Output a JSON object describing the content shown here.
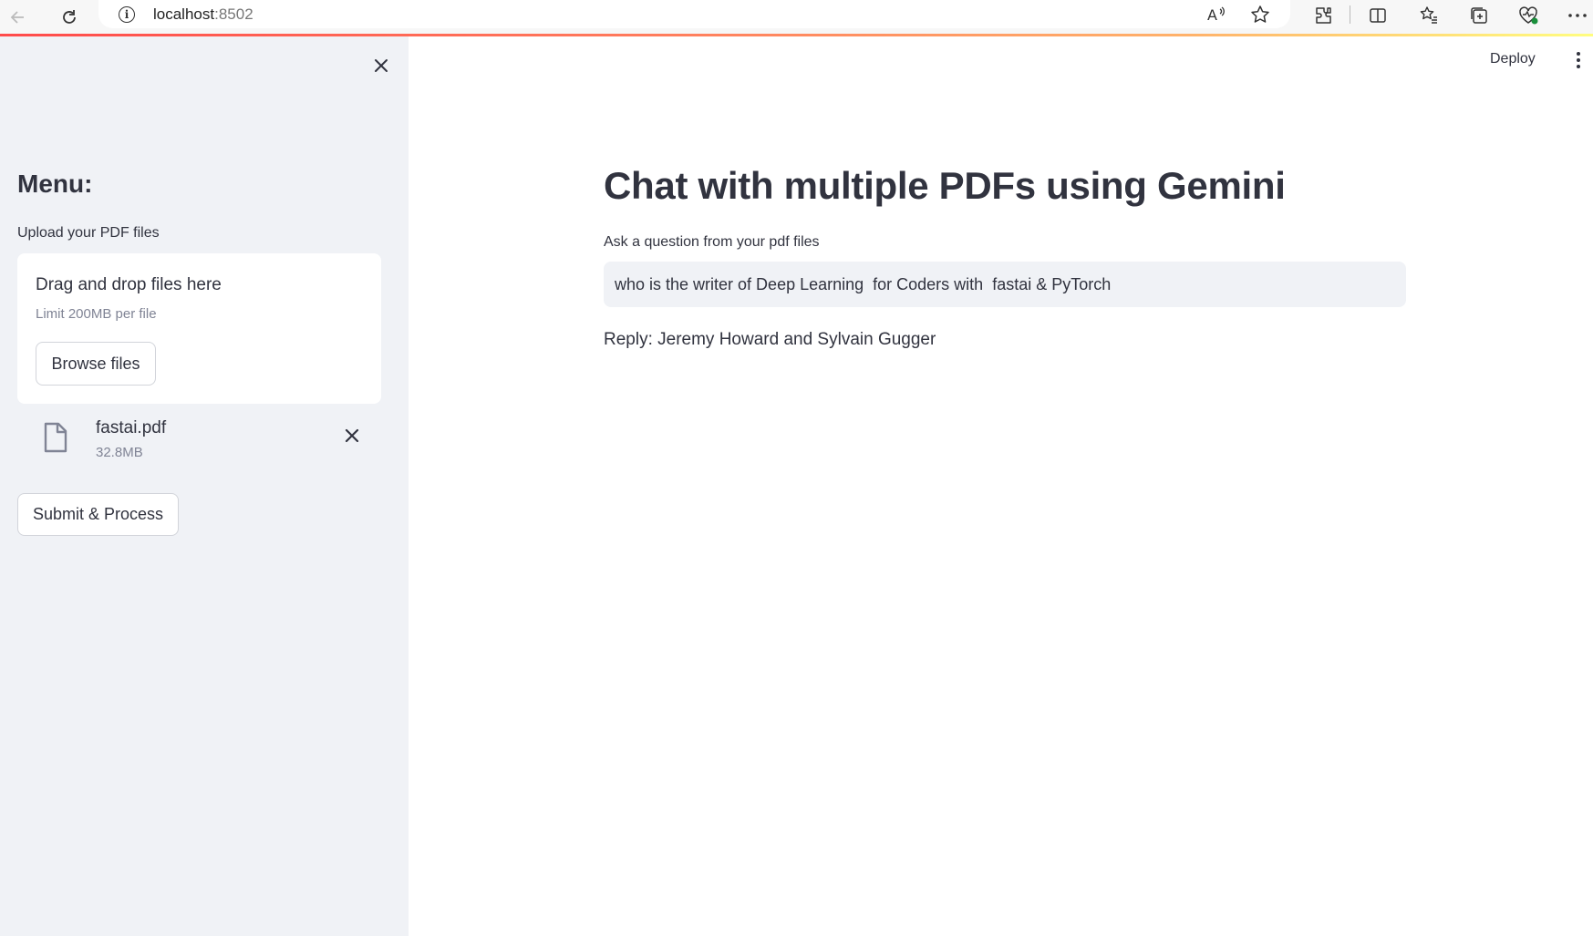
{
  "browser": {
    "url_host": "localhost",
    "url_port": ":8502"
  },
  "sidebar": {
    "title": "Menu:",
    "upload_label": "Upload your PDF files",
    "dropzone": {
      "title": "Drag and drop files here",
      "limit": "Limit 200MB per file",
      "browse_label": "Browse files"
    },
    "files": [
      {
        "name": "fastai.pdf",
        "size": "32.8MB"
      }
    ],
    "submit_label": "Submit & Process"
  },
  "header": {
    "deploy_label": "Deploy"
  },
  "main": {
    "title": "Chat with multiple PDFs using Gemini",
    "question_label": "Ask a question from your pdf files",
    "question_value": "who is the writer of Deep Learning  for Coders with  fastai & PyTorch",
    "reply": "Reply: Jeremy Howard and Sylvain Gugger"
  },
  "colors": {
    "sidebar_bg": "#f0f2f6",
    "text": "#31333f",
    "muted": "#808495",
    "accent": "#ff4b4b"
  }
}
